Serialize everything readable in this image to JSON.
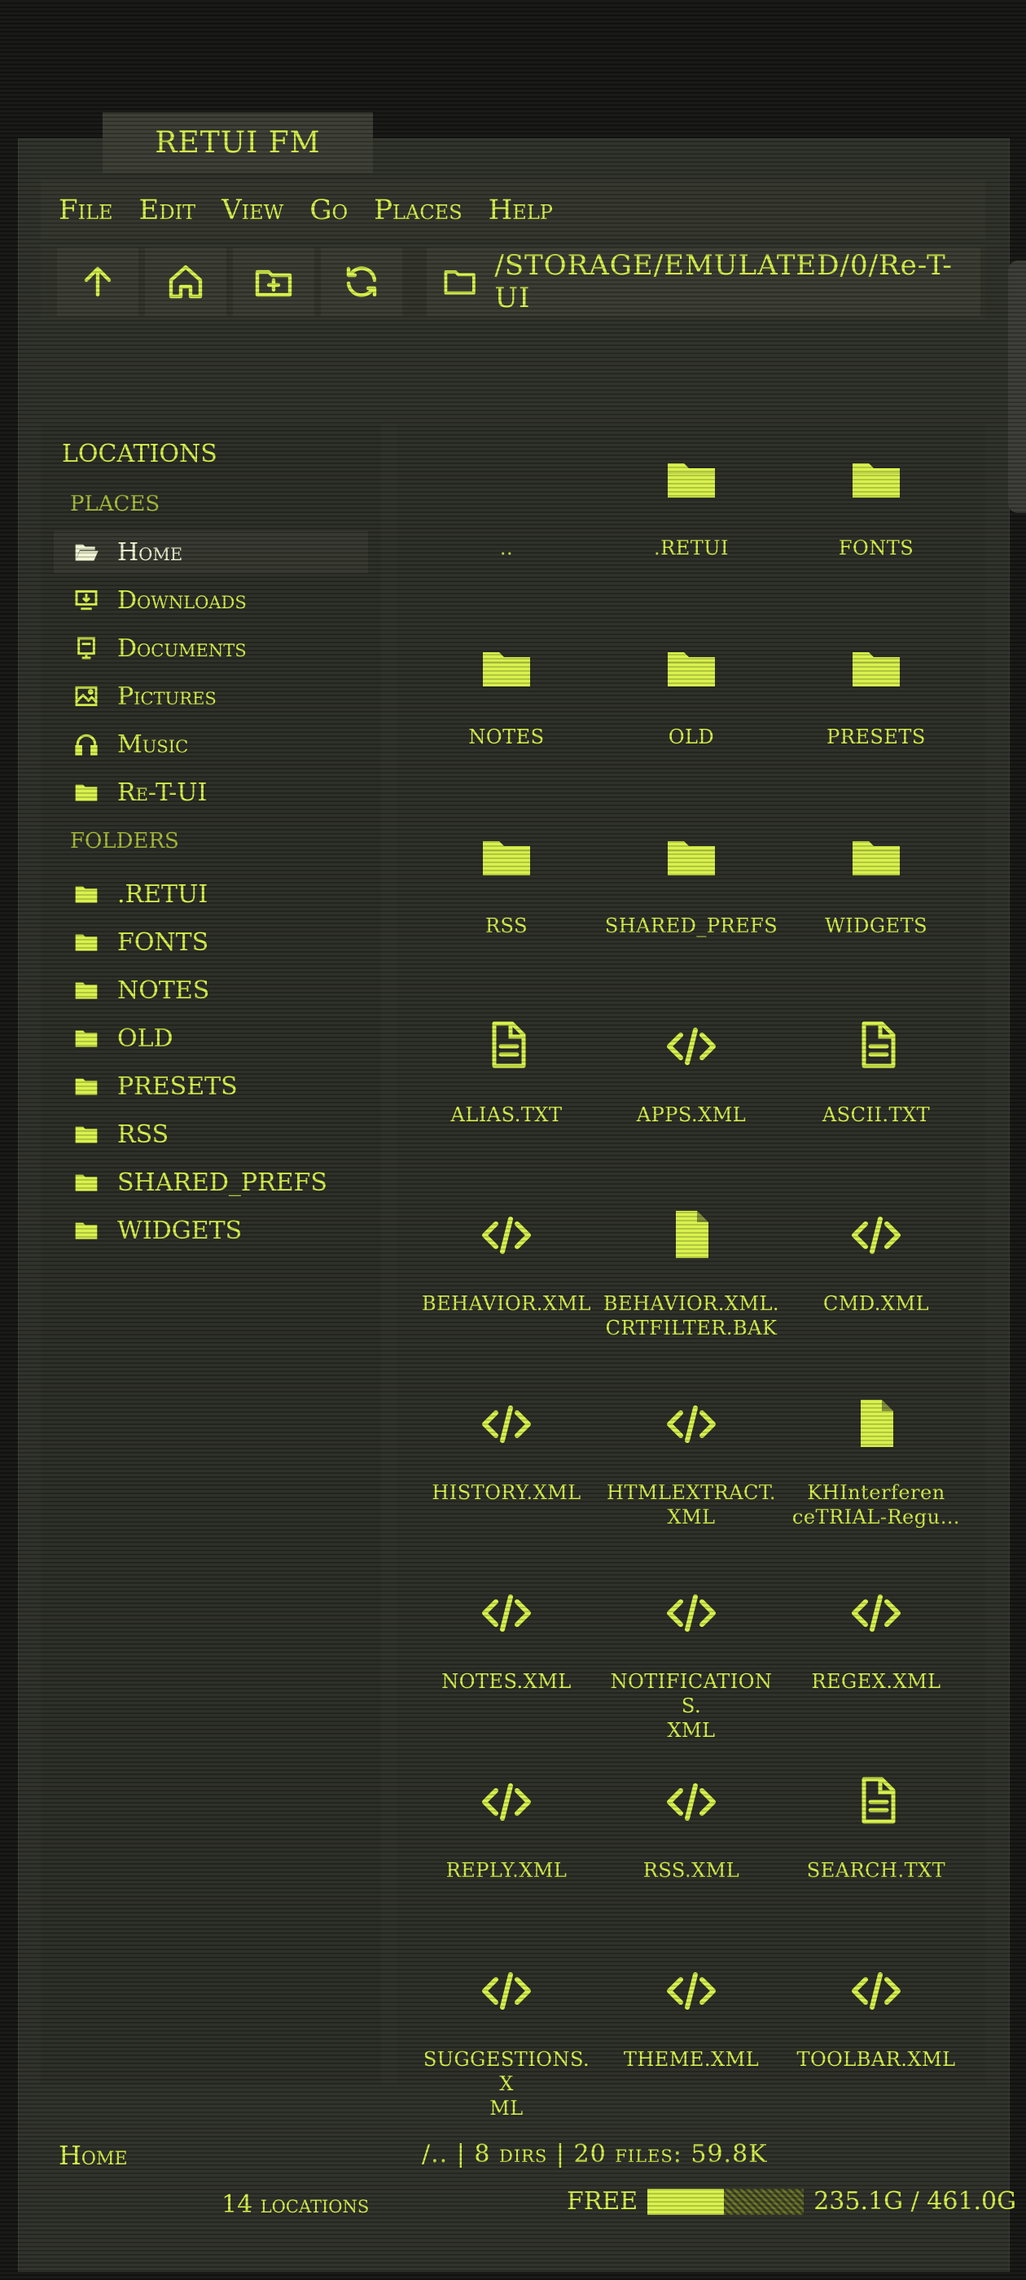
{
  "app": {
    "title": "RETUI FM"
  },
  "menu": [
    "File",
    "Edit",
    "View",
    "Go",
    "Places",
    "Help"
  ],
  "toolbar": {
    "buttons": [
      "arrow-up-icon",
      "home-icon",
      "folder-plus-icon",
      "refresh-icon"
    ],
    "path": "/STORAGE/EMULATED/0/Re-T-UI"
  },
  "sidebar": {
    "heading": "LOCATIONS",
    "places_label": "PLACES",
    "places": [
      {
        "label": "Home",
        "icon": "folder-open-icon",
        "active": true
      },
      {
        "label": "Downloads",
        "icon": "download-icon"
      },
      {
        "label": "Documents",
        "icon": "document-icon"
      },
      {
        "label": "Pictures",
        "icon": "image-icon"
      },
      {
        "label": "Music",
        "icon": "headphones-icon"
      },
      {
        "label": "Re-T-UI",
        "icon": "folder-icon"
      }
    ],
    "folders_label": "FOLDERS",
    "folders": [
      ".RETUI",
      "FONTS",
      "NOTES",
      "OLD",
      "PRESETS",
      "RSS",
      "SHARED_PREFS",
      "WIDGETS"
    ]
  },
  "files": [
    {
      "name": "..",
      "type": "parent"
    },
    {
      "name": ".RETUI",
      "type": "folder"
    },
    {
      "name": "FONTS",
      "type": "folder"
    },
    {
      "name": "NOTES",
      "type": "folder"
    },
    {
      "name": "OLD",
      "type": "folder"
    },
    {
      "name": "PRESETS",
      "type": "folder"
    },
    {
      "name": "RSS",
      "type": "folder"
    },
    {
      "name": "SHARED_PREFS",
      "type": "folder"
    },
    {
      "name": "WIDGETS",
      "type": "folder"
    },
    {
      "name": "ALIAS.TXT",
      "type": "text"
    },
    {
      "name": "APPS.XML",
      "type": "code"
    },
    {
      "name": "ASCII.TXT",
      "type": "text"
    },
    {
      "name": "BEHAVIOR.XML",
      "type": "code"
    },
    {
      "name": "BEHAVIOR.XML.\nCRTFILTER.BAK",
      "type": "file"
    },
    {
      "name": "CMD.XML",
      "type": "code"
    },
    {
      "name": "HISTORY.XML",
      "type": "code"
    },
    {
      "name": "HTMLEXTRACT.\nXML",
      "type": "code"
    },
    {
      "name": "KHInterferen\nceTRIAL-Regu…",
      "type": "file"
    },
    {
      "name": "NOTES.XML",
      "type": "code"
    },
    {
      "name": "NOTIFICATIONS.\nXML",
      "type": "code"
    },
    {
      "name": "REGEX.XML",
      "type": "code"
    },
    {
      "name": "REPLY.XML",
      "type": "code"
    },
    {
      "name": "RSS.XML",
      "type": "code"
    },
    {
      "name": "SEARCH.TXT",
      "type": "text"
    },
    {
      "name": "SUGGESTIONS.X\nML",
      "type": "code"
    },
    {
      "name": "THEME.XML",
      "type": "code"
    },
    {
      "name": "TOOLBAR.XML",
      "type": "code"
    }
  ],
  "status": {
    "location": "Home",
    "summary": "/..  |  8 dirs | 20 files: 59.8K",
    "locations_count": "14 locations",
    "free_label": "FREE",
    "disk": "235.1G / 461.0G",
    "used_fraction": 0.49
  },
  "colors": {
    "accent": "#d8f24a",
    "bg": "#2d2f28"
  }
}
